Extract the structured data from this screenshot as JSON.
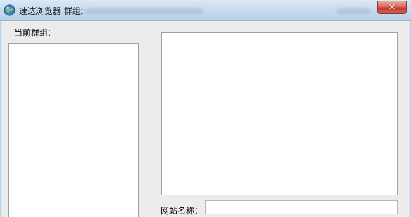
{
  "window": {
    "title": "速达浏览器 群组:",
    "close_label": "✕"
  },
  "left_pane": {
    "group_label": "当前群组：",
    "groups": []
  },
  "right_pane": {
    "sites": [],
    "site_name_label": "网站名称：",
    "site_name_value": "",
    "site_name_placeholder": ""
  },
  "icons": {
    "app": "globe-icon",
    "close": "close-icon"
  },
  "colors": {
    "titlebar": "#c9dcef",
    "close_button": "#c2382a",
    "background": "#ececec"
  }
}
